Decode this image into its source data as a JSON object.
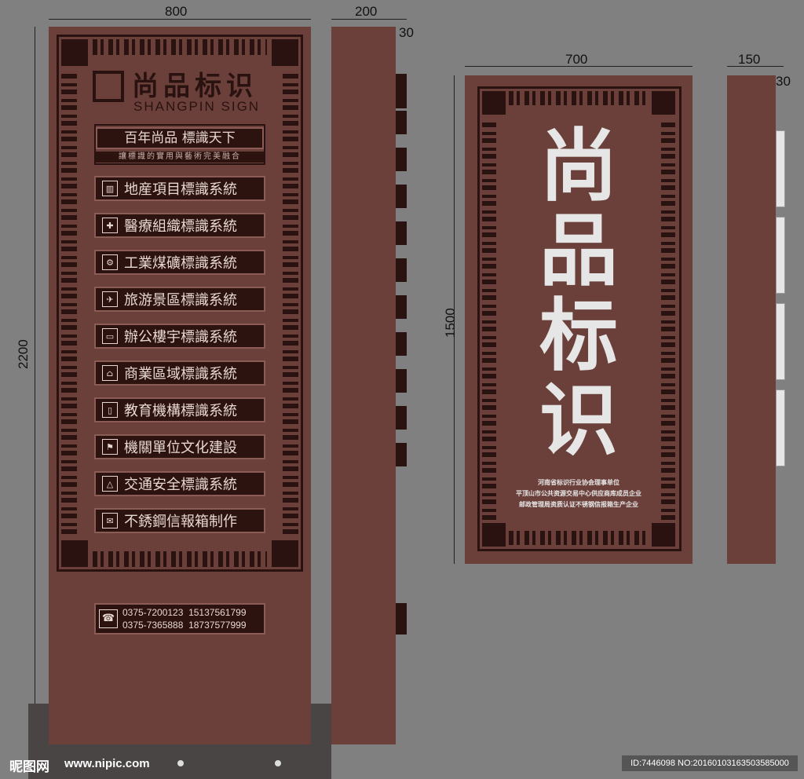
{
  "dimensions": {
    "left_width": "800",
    "left_depth": "200",
    "left_depth_thin": "30",
    "left_height": "2200",
    "right_width": "700",
    "right_depth": "150",
    "right_depth_thin": "30",
    "right_height": "1500"
  },
  "left_sign": {
    "logo_cn": "尚品标识",
    "logo_en": "SHANGPIN SIGN",
    "slogan": "百年尚品  標識天下",
    "slogan_sub": "讓標識的實用與藝術完美融合",
    "categories": [
      {
        "icon": "building-icon",
        "label": "地産項目標識系統"
      },
      {
        "icon": "medical-icon",
        "label": "醫療組織標識系統"
      },
      {
        "icon": "gear-icon",
        "label": "工業煤礦標識系統"
      },
      {
        "icon": "travel-icon",
        "label": "旅游景區標識系統"
      },
      {
        "icon": "computer-icon",
        "label": "辦公樓宇標識系統"
      },
      {
        "icon": "shop-icon",
        "label": "商業區域標識系統"
      },
      {
        "icon": "book-icon",
        "label": "教育機構標識系統"
      },
      {
        "icon": "flag-icon",
        "label": "機關單位文化建設"
      },
      {
        "icon": "traffic-icon",
        "label": "交通安全標識系統"
      },
      {
        "icon": "mailbox-icon",
        "label": "不銹鋼信報箱制作"
      }
    ],
    "phones_line1": "0375-7200123  15137561799",
    "phones_line2": "0375-7365888  18737577999"
  },
  "right_sign": {
    "big_text": [
      "尚",
      "品",
      "标",
      "识"
    ],
    "info_lines": [
      "河南省标识行业协会理事单位",
      "平顶山市公共资源交易中心供应商库成员企业",
      "邮政管理局资质认证不锈钢信报箱生产企业"
    ]
  },
  "footer": {
    "watermark_cn": "昵图网",
    "watermark_url": "www.nipic.com",
    "image_id": "ID:7446098 NO:20160103163503585000"
  },
  "colors": {
    "background": "#808080",
    "panel": "#6b403a",
    "dark": "#2a1210",
    "light_text": "#e8d8d2"
  }
}
